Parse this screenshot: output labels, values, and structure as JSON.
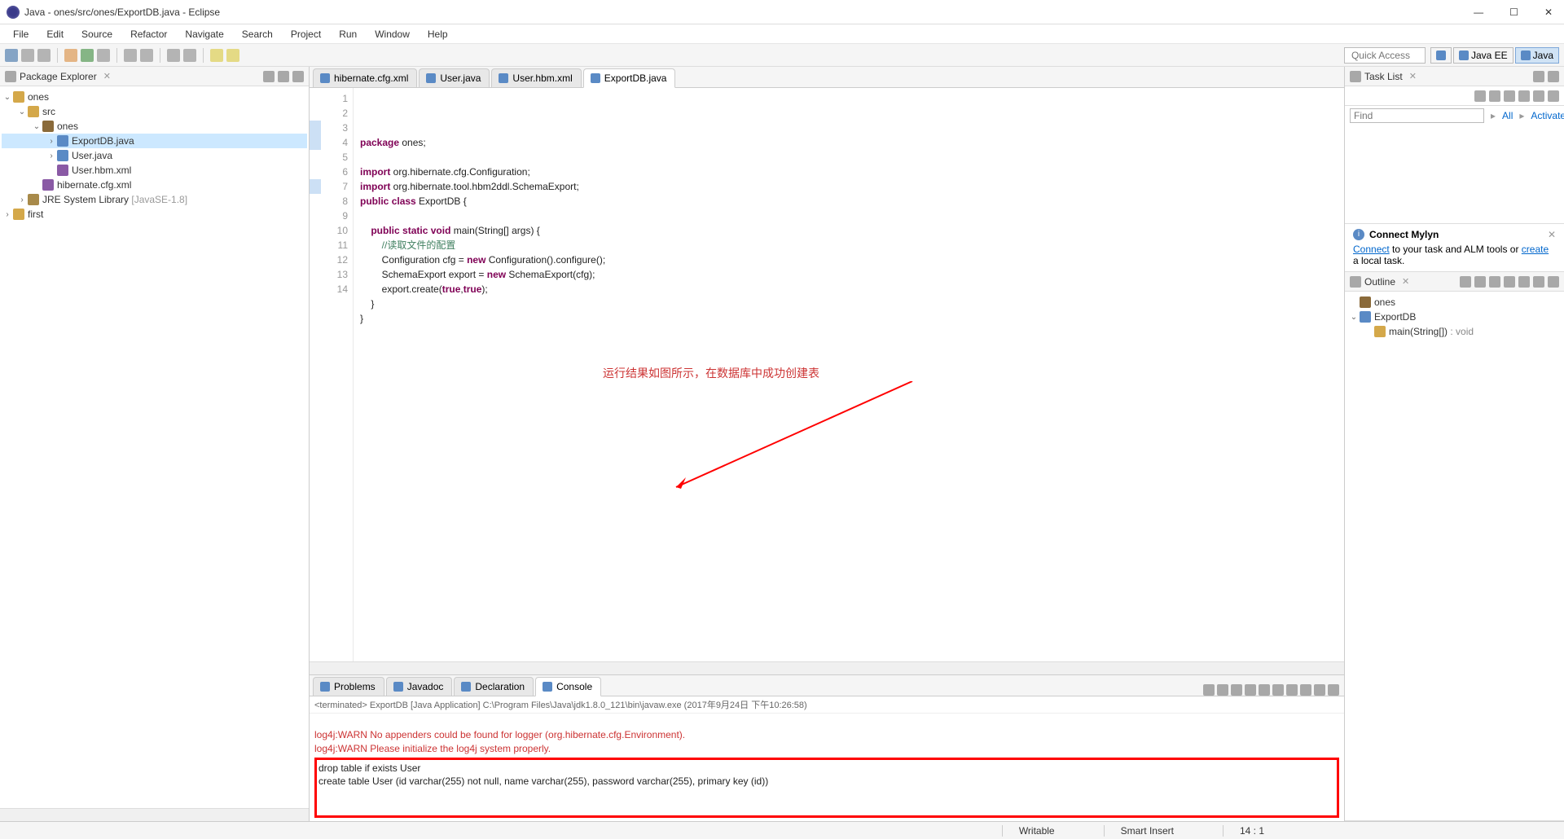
{
  "window": {
    "title": "Java - ones/src/ones/ExportDB.java - Eclipse"
  },
  "menu": [
    "File",
    "Edit",
    "Source",
    "Refactor",
    "Navigate",
    "Search",
    "Project",
    "Run",
    "Window",
    "Help"
  ],
  "quick_access": "Quick Access",
  "perspectives": [
    {
      "label": "Java EE",
      "active": false
    },
    {
      "label": "Java",
      "active": true
    }
  ],
  "package_explorer": {
    "title": "Package Explorer",
    "tree": [
      {
        "depth": 0,
        "exp": "v",
        "icon": "proj",
        "label": "ones"
      },
      {
        "depth": 1,
        "exp": "v",
        "icon": "folder",
        "label": "src"
      },
      {
        "depth": 2,
        "exp": "v",
        "icon": "pkg",
        "label": "ones"
      },
      {
        "depth": 3,
        "exp": ">",
        "icon": "java",
        "label": "ExportDB.java",
        "sel": true
      },
      {
        "depth": 3,
        "exp": ">",
        "icon": "java",
        "label": "User.java"
      },
      {
        "depth": 3,
        "exp": "",
        "icon": "xml",
        "label": "User.hbm.xml"
      },
      {
        "depth": 2,
        "exp": "",
        "icon": "xml",
        "label": "hibernate.cfg.xml"
      },
      {
        "depth": 1,
        "exp": ">",
        "icon": "lib",
        "label": "JRE System Library",
        "suffix": "[JavaSE-1.8]"
      },
      {
        "depth": 0,
        "exp": ">",
        "icon": "proj",
        "label": "first"
      }
    ]
  },
  "editor_tabs": [
    {
      "label": "hibernate.cfg.xml",
      "active": false
    },
    {
      "label": "User.java",
      "active": false
    },
    {
      "label": "User.hbm.xml",
      "active": false
    },
    {
      "label": "ExportDB.java",
      "active": true
    }
  ],
  "code": {
    "lines": [
      {
        "n": 1,
        "html": "<span class='kw'>package</span> ones;"
      },
      {
        "n": 2,
        "html": ""
      },
      {
        "n": 3,
        "html": "<span class='kw'>import</span> org.hibernate.cfg.Configuration;"
      },
      {
        "n": 4,
        "html": "<span class='kw'>import</span> org.hibernate.tool.hbm2ddl.SchemaExport;"
      },
      {
        "n": 5,
        "html": "<span class='kw'>public</span> <span class='kw'>class</span> ExportDB {"
      },
      {
        "n": 6,
        "html": ""
      },
      {
        "n": 7,
        "html": "    <span class='kw'>public</span> <span class='kw'>static</span> <span class='kw'>void</span> main(String[] args) {"
      },
      {
        "n": 8,
        "html": "        <span class='cm'>//读取文件的配置</span>"
      },
      {
        "n": 9,
        "html": "        Configuration cfg = <span class='kw'>new</span> Configuration().configure();"
      },
      {
        "n": 10,
        "html": "        SchemaExport export = <span class='kw'>new</span> SchemaExport(cfg);"
      },
      {
        "n": 11,
        "html": "        export.create(<span class='kw'>true</span>,<span class='kw'>true</span>);"
      },
      {
        "n": 12,
        "html": "    }"
      },
      {
        "n": 13,
        "html": "}"
      },
      {
        "n": 14,
        "html": ""
      }
    ]
  },
  "annotation": "运行结果如图所示，在数据库中成功创建表",
  "bottom_tabs": [
    "Problems",
    "Javadoc",
    "Declaration",
    "Console"
  ],
  "console": {
    "header": "<terminated> ExportDB [Java Application] C:\\Program Files\\Java\\jdk1.8.0_121\\bin\\javaw.exe (2017年9月24日 下午10:26:58)",
    "warn1": "log4j:WARN No appenders could be found for logger (org.hibernate.cfg.Environment).",
    "warn2": "log4j:WARN Please initialize the log4j system properly.",
    "out1": "drop table if exists User",
    "out2": "create table User (id varchar(255) not null, name varchar(255), password varchar(255), primary key (id))"
  },
  "tasklist": {
    "title": "Task List",
    "find": "Find",
    "all": "All",
    "activate": "Activate..."
  },
  "mylyn": {
    "title": "Connect Mylyn",
    "text1": "Connect",
    "text2": " to your task and ALM tools or ",
    "text3": "create",
    "text4": " a local task."
  },
  "outline": {
    "title": "Outline",
    "items": [
      {
        "depth": 0,
        "exp": "",
        "icon": "pkg",
        "label": "ones"
      },
      {
        "depth": 0,
        "exp": "v",
        "icon": "class",
        "label": "ExportDB"
      },
      {
        "depth": 1,
        "exp": "",
        "icon": "method",
        "label": "main(String[]) : void"
      }
    ]
  },
  "status": {
    "writable": "Writable",
    "insert": "Smart Insert",
    "pos": "14 : 1"
  }
}
